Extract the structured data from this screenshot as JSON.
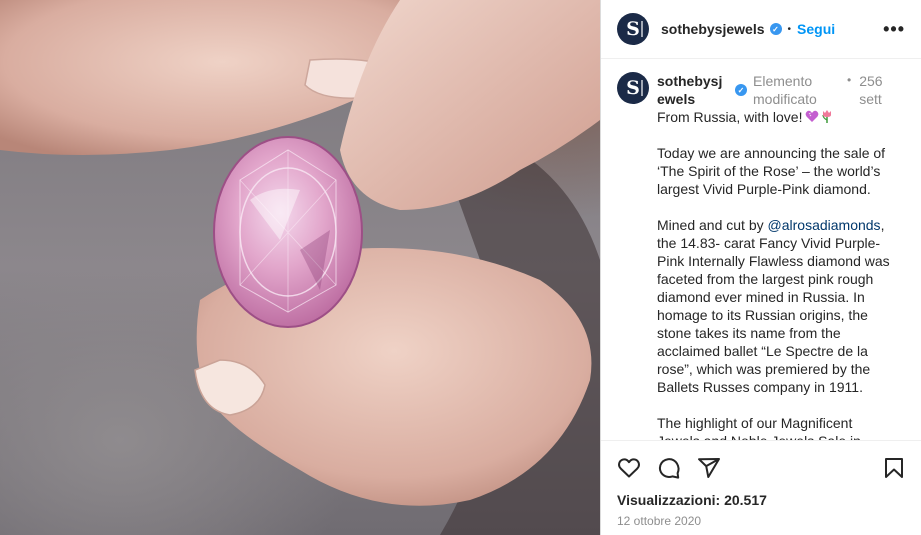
{
  "post": {
    "username": "sothebysjewels",
    "avatar_letter": "S",
    "follow_label": "Segui",
    "separator": "•",
    "more_label": "•••",
    "verified_mark": "✓"
  },
  "caption": {
    "username_line1": "sothebysj",
    "username_line2": "ewels",
    "edited_label": "Elemento modificato",
    "separator": "•",
    "time_label": "256 sett",
    "line_intro": "From Russia, with love!",
    "paragraph_2": "Today we are announcing the sale of ‘The Spirit of the Rose’ – the world’s largest Vivid Purple-Pink diamond.",
    "paragraph_3_prefix": "Mined and cut by ",
    "paragraph_3_mention": "@alrosadiamonds",
    "paragraph_3_rest": ", the 14.83- carat Fancy Vivid Purple-Pink Internally Flawless diamond was faceted from the largest pink rough diamond ever mined in Russia. In homage to its Russian origins, the stone takes its name from the acclaimed ballet “Le Spectre de la rose”, which was premiered by the Ballets Russes company in 1911.",
    "paragraph_4": "The highlight of our Magnificent Jewels and Noble Jewels Sale in"
  },
  "footer": {
    "views_label": "Visualizzazioni: 20.517",
    "date_label": "12 ottobre 2020"
  },
  "icons": {
    "like": "heart-icon",
    "comment": "comment-icon",
    "share": "share-icon",
    "save": "bookmark-icon",
    "verified": "verified-badge-icon"
  },
  "colors": {
    "accent": "#0095f6",
    "mention": "#00376b",
    "verified": "#3897f0",
    "muted": "#8e8e8e",
    "avatar_bg": "#1b2a47"
  }
}
